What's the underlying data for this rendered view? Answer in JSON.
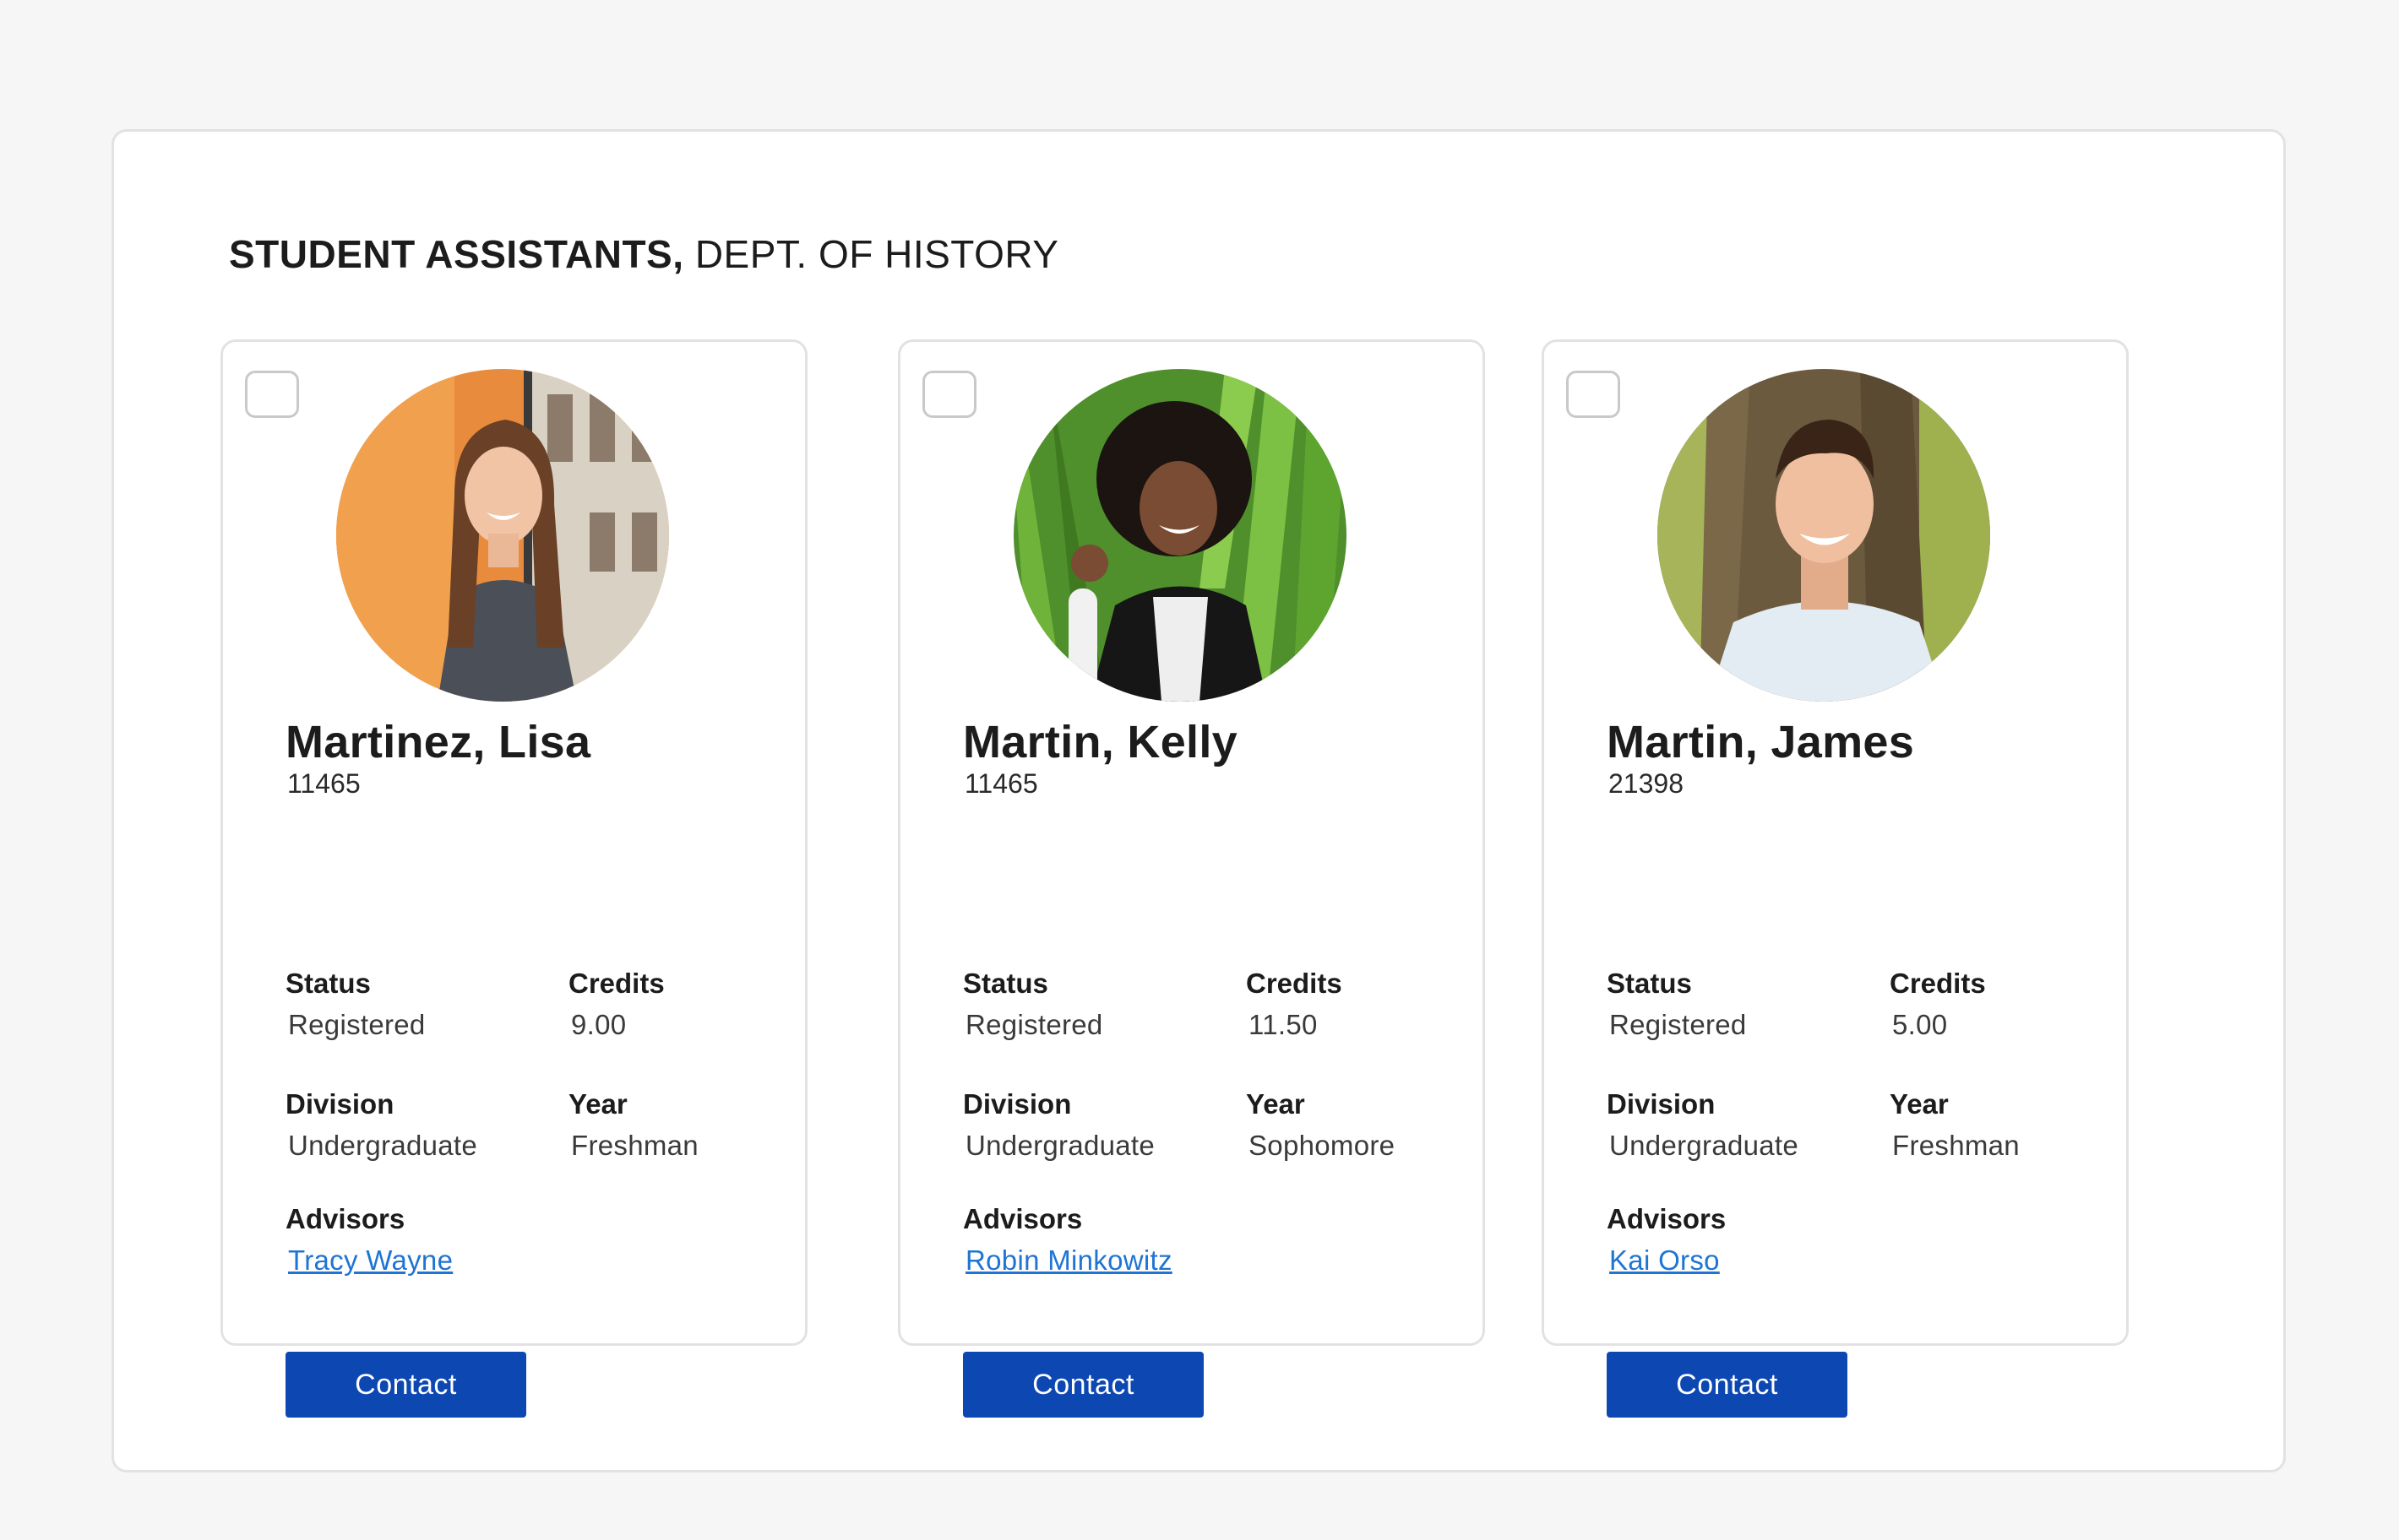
{
  "header": {
    "title_strong": "STUDENT ASSISTANTS,",
    "title_rest": "DEPT. OF HISTORY"
  },
  "labels": {
    "status": "Status",
    "credits": "Credits",
    "division": "Division",
    "year": "Year",
    "advisors": "Advisors",
    "contact": "Contact"
  },
  "colors": {
    "accent": "#0c47b2",
    "link": "#1f74d4",
    "card_border": "#e2e2e2",
    "background": "#f6f6f6"
  },
  "students": [
    {
      "name": "Martinez, Lisa",
      "id": "11465",
      "status": "Registered",
      "credits": "9.00",
      "division": "Undergraduate",
      "year": "Freshman",
      "advisor": "Tracy Wayne",
      "photo_icon": "portrait-photo"
    },
    {
      "name": "Martin, Kelly",
      "id": "11465",
      "status": "Registered",
      "credits": "11.50",
      "division": "Undergraduate",
      "year": "Sophomore",
      "advisor": "Robin Minkowitz",
      "photo_icon": "portrait-photo"
    },
    {
      "name": "Martin, James",
      "id": "21398",
      "status": "Registered",
      "credits": "5.00",
      "division": "Undergraduate",
      "year": "Freshman",
      "advisor": "Kai Orso",
      "photo_icon": "portrait-photo"
    }
  ]
}
